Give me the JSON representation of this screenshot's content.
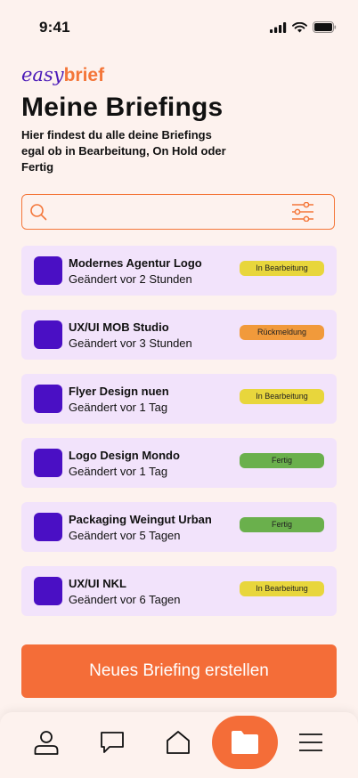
{
  "status_bar": {
    "time": "9:41"
  },
  "brand": {
    "part1": "easy",
    "part2": "brief"
  },
  "header": {
    "title": "Meine Briefings",
    "subtitle": "Hier findest du alle deine Briefings egal ob in Bearbeitung, On Hold oder Fertig"
  },
  "search": {
    "placeholder": "",
    "value": ""
  },
  "briefings": [
    {
      "title": "Modernes Agentur Logo",
      "changed": "Geändert vor 2 Stunden",
      "status": "In Bearbeitung",
      "status_color": "#e8d63c"
    },
    {
      "title": "UX/UI MOB Studio",
      "changed": "Geändert vor 3 Stunden",
      "status": "Rückmeldung",
      "status_color": "#f19a3b"
    },
    {
      "title": "Flyer Design nuen",
      "changed": "Geändert vor 1 Tag",
      "status": "In Bearbeitung",
      "status_color": "#e8d63c"
    },
    {
      "title": "Logo Design Mondo",
      "changed": "Geändert vor 1 Tag",
      "status": "Fertig",
      "status_color": "#6ab04c"
    },
    {
      "title": "Packaging Weingut Urban",
      "changed": "Geändert vor 5 Tagen",
      "status": "Fertig",
      "status_color": "#6ab04c"
    },
    {
      "title": "UX/UI NKL",
      "changed": "Geändert vor 6 Tagen",
      "status": "In Bearbeitung",
      "status_color": "#e8d63c"
    }
  ],
  "cta": {
    "label": "Neues Briefing erstellen"
  },
  "colors": {
    "accent": "#f46d38",
    "brand_purple": "#4a0fc4",
    "card_bg": "#f2e3fb",
    "page_bg": "#fdf2ee"
  },
  "bottom_nav": {
    "items": [
      {
        "icon": "profile-icon"
      },
      {
        "icon": "chat-icon"
      },
      {
        "icon": "home-icon"
      },
      {
        "icon": "folder-icon",
        "active": true
      },
      {
        "icon": "menu-icon"
      }
    ]
  }
}
